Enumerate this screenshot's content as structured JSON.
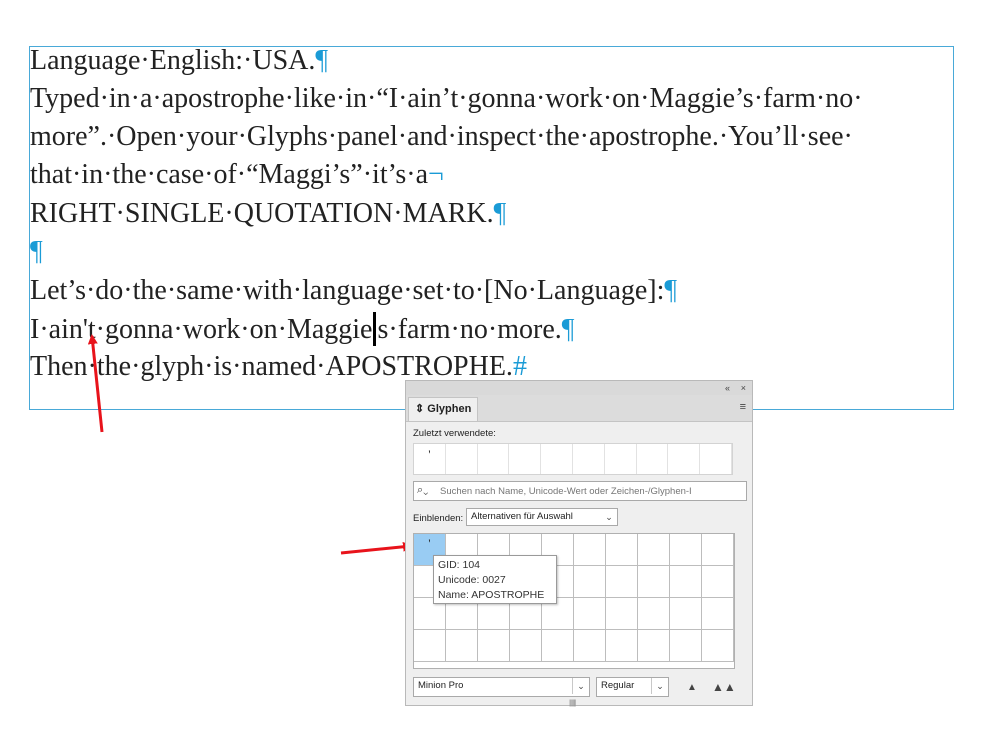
{
  "text_frame": {
    "lines": [
      "Language·English:·USA.",
      "Typed·in·a·apostrophe·like·in·“I·ain’t·gonna·work·on·Maggie’s·farm·no·",
      "more”.·Open·your·Glyphs·panel·and·inspect·the·apostrophe.·You’ll·see·",
      "that·in·the·case·of·“Maggi’s”·it’s·a",
      "RIGHT·SINGLE·QUOTATION·MARK.",
      "",
      "Let’s·do·the·same·with·language·set·to·[No·Language]:",
      "I·ain't·gonna·work·on·Maggie",
      "s·farm·no·more.",
      "Then·the·glyph·is·named·APOSTROPHE."
    ],
    "pilcrow": "¶",
    "hash": "#",
    "line_end_marker": "¬"
  },
  "panel": {
    "title": "Glyphen",
    "collapse_icon": "«",
    "close_icon": "×",
    "menu_icon": "≡",
    "recent_label": "Zuletzt verwendete:",
    "recent_glyph": "'",
    "search_placeholder": "Suchen nach Name, Unicode-Wert oder Zeichen-/Glyphen-I",
    "show_label": "Einblenden:",
    "show_value": "Alternativen für Auswahl",
    "selected_glyph": "'",
    "tooltip": {
      "gid": "GID: 104",
      "unicode": "Unicode: 0027",
      "name": "Name: APOSTROPHE"
    },
    "font": "Minion Pro",
    "style": "Regular"
  },
  "colors": {
    "frame_border": "#49a9d8",
    "hidden_chars": "#1a9bd6",
    "arrow": "#e8131b",
    "selected_cell": "#99ccf3"
  }
}
